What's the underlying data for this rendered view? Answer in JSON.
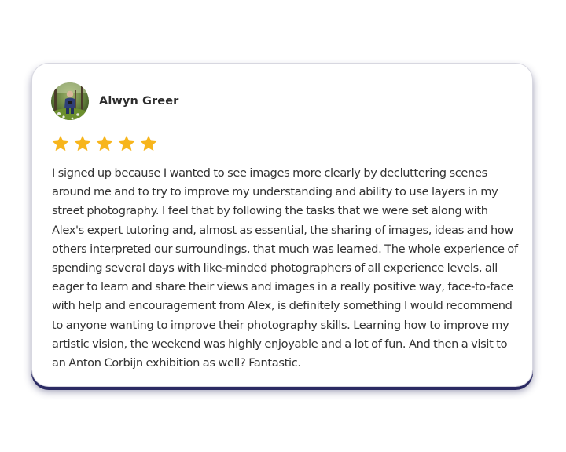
{
  "testimonial": {
    "author_name": "Alwyn Greer",
    "avatar_alt": "Alwyn Greer",
    "rating": 5,
    "rating_max": 5,
    "star_color": "#F7B51C",
    "review_text": "I signed up because I wanted to see images more clearly by decluttering scenes around me and to try to improve my understanding and ability to use layers in my street photography. I feel that by following the tasks that we were set along with Alex's expert tutoring and, almost as essential, the sharing of images, ideas and how others interpreted our surroundings, that much was learned. The whole experience of spending several days with like-minded photographers of all experience levels, all eager to learn and share their views and images in a really positive way, face-to-face with help and encouragement from Alex, is definitely something I would recommend to anyone wanting to improve their photography skills. Learning how to improve my artistic vision, the weekend was highly enjoyable and a lot of fun. And then a visit to an Anton Corbijn exhibition as well? Fantastic."
  },
  "colors": {
    "card_background": "#FFFFFF",
    "card_shadow": "#2B2A63",
    "text": "#333333",
    "star": "#F7B51C"
  },
  "icons": {
    "avatar": "person-photo-avatar",
    "rating_star": "star-icon"
  }
}
